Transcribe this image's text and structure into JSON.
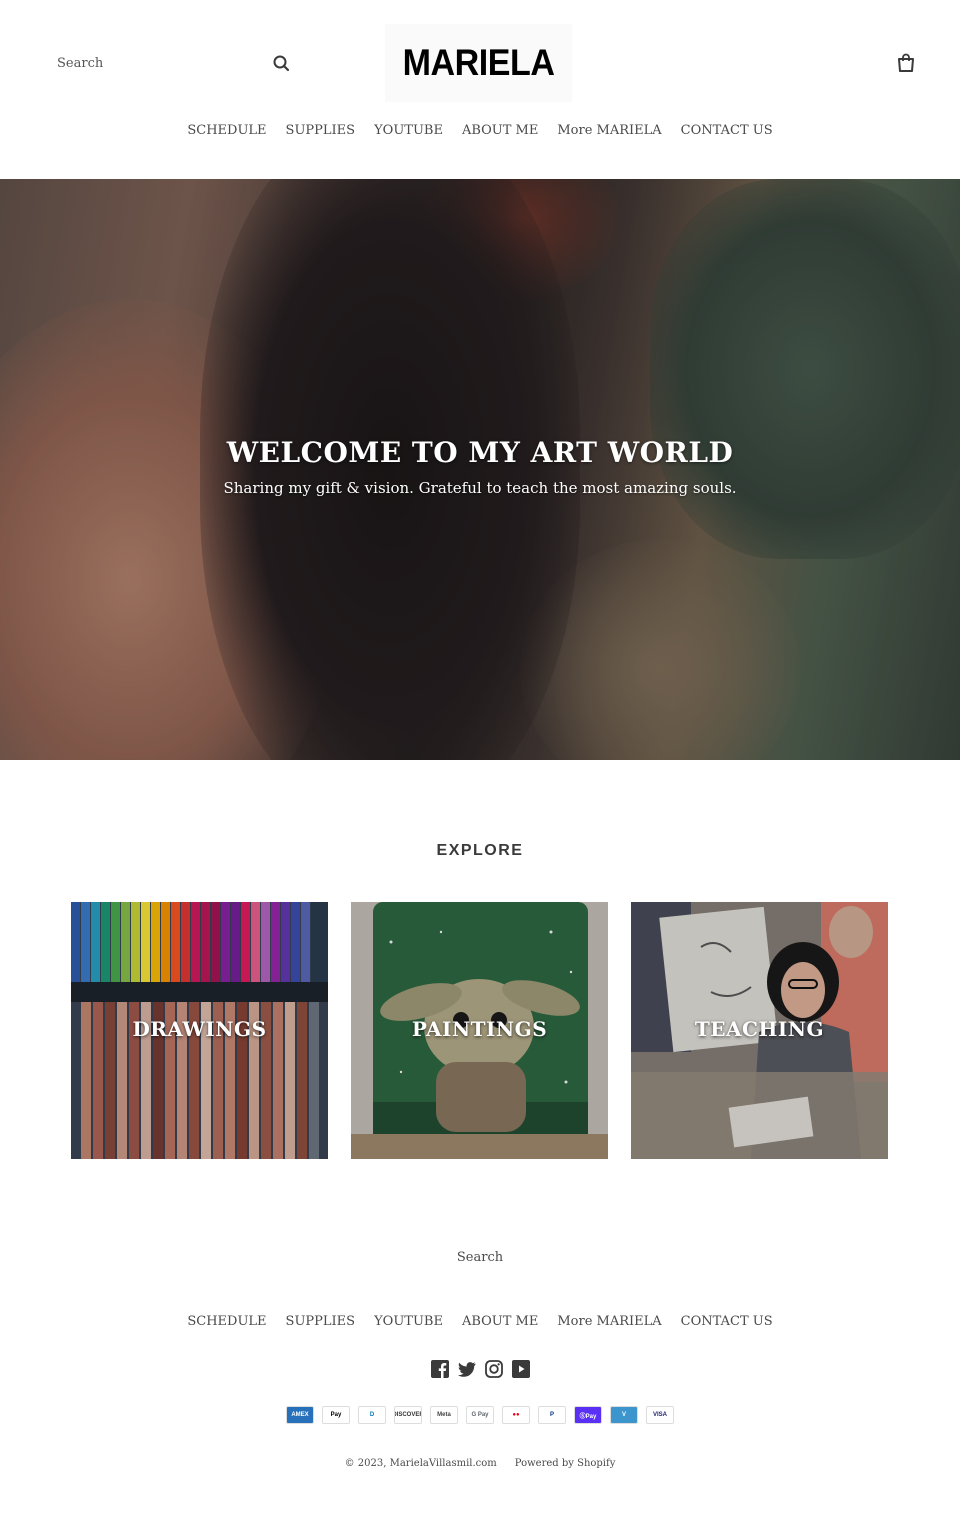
{
  "header": {
    "search_placeholder": "Search",
    "logo_text": "MARIELA"
  },
  "nav": {
    "items": [
      "SCHEDULE",
      "SUPPLIES",
      "YOUTUBE",
      "ABOUT ME",
      "More MARIELA",
      "CONTACT US"
    ]
  },
  "hero": {
    "title": "WELCOME TO MY ART WORLD",
    "subtitle": "Sharing my gift & vision. Grateful to teach the most amazing souls."
  },
  "explore": {
    "title": "EXPLORE",
    "tiles": [
      "DRAWINGS",
      "PAINTINGS",
      "TEACHING"
    ]
  },
  "footer": {
    "search_link": "Search",
    "social_icons": [
      "facebook-icon",
      "twitter-icon",
      "instagram-icon",
      "youtube-icon"
    ],
    "payments": [
      {
        "name": "AMEX",
        "bg": "#2671b9",
        "fg": "#ffffff"
      },
      {
        "name": "Pay",
        "bg": "#ffffff",
        "fg": "#000000"
      },
      {
        "name": "D",
        "bg": "#ffffff",
        "fg": "#0079be"
      },
      {
        "name": "DISCOVER",
        "bg": "#ffffff",
        "fg": "#333333"
      },
      {
        "name": "Meta",
        "bg": "#ffffff",
        "fg": "#444444"
      },
      {
        "name": "G Pay",
        "bg": "#ffffff",
        "fg": "#5f6368"
      },
      {
        "name": "●●",
        "bg": "#ffffff",
        "fg": "#eb001b"
      },
      {
        "name": "P",
        "bg": "#ffffff",
        "fg": "#003087"
      },
      {
        "name": "ⓈPay",
        "bg": "#5a31f4",
        "fg": "#ffffff"
      },
      {
        "name": "V",
        "bg": "#3d95ce",
        "fg": "#ffffff"
      },
      {
        "name": "VISA",
        "bg": "#ffffff",
        "fg": "#1a1f71"
      }
    ],
    "copyright": "© 2023, MarielaVillasmil.com",
    "powered_by": "Powered by Shopify"
  },
  "colors": {
    "text": "#3a3a3a",
    "background": "#ffffff"
  }
}
